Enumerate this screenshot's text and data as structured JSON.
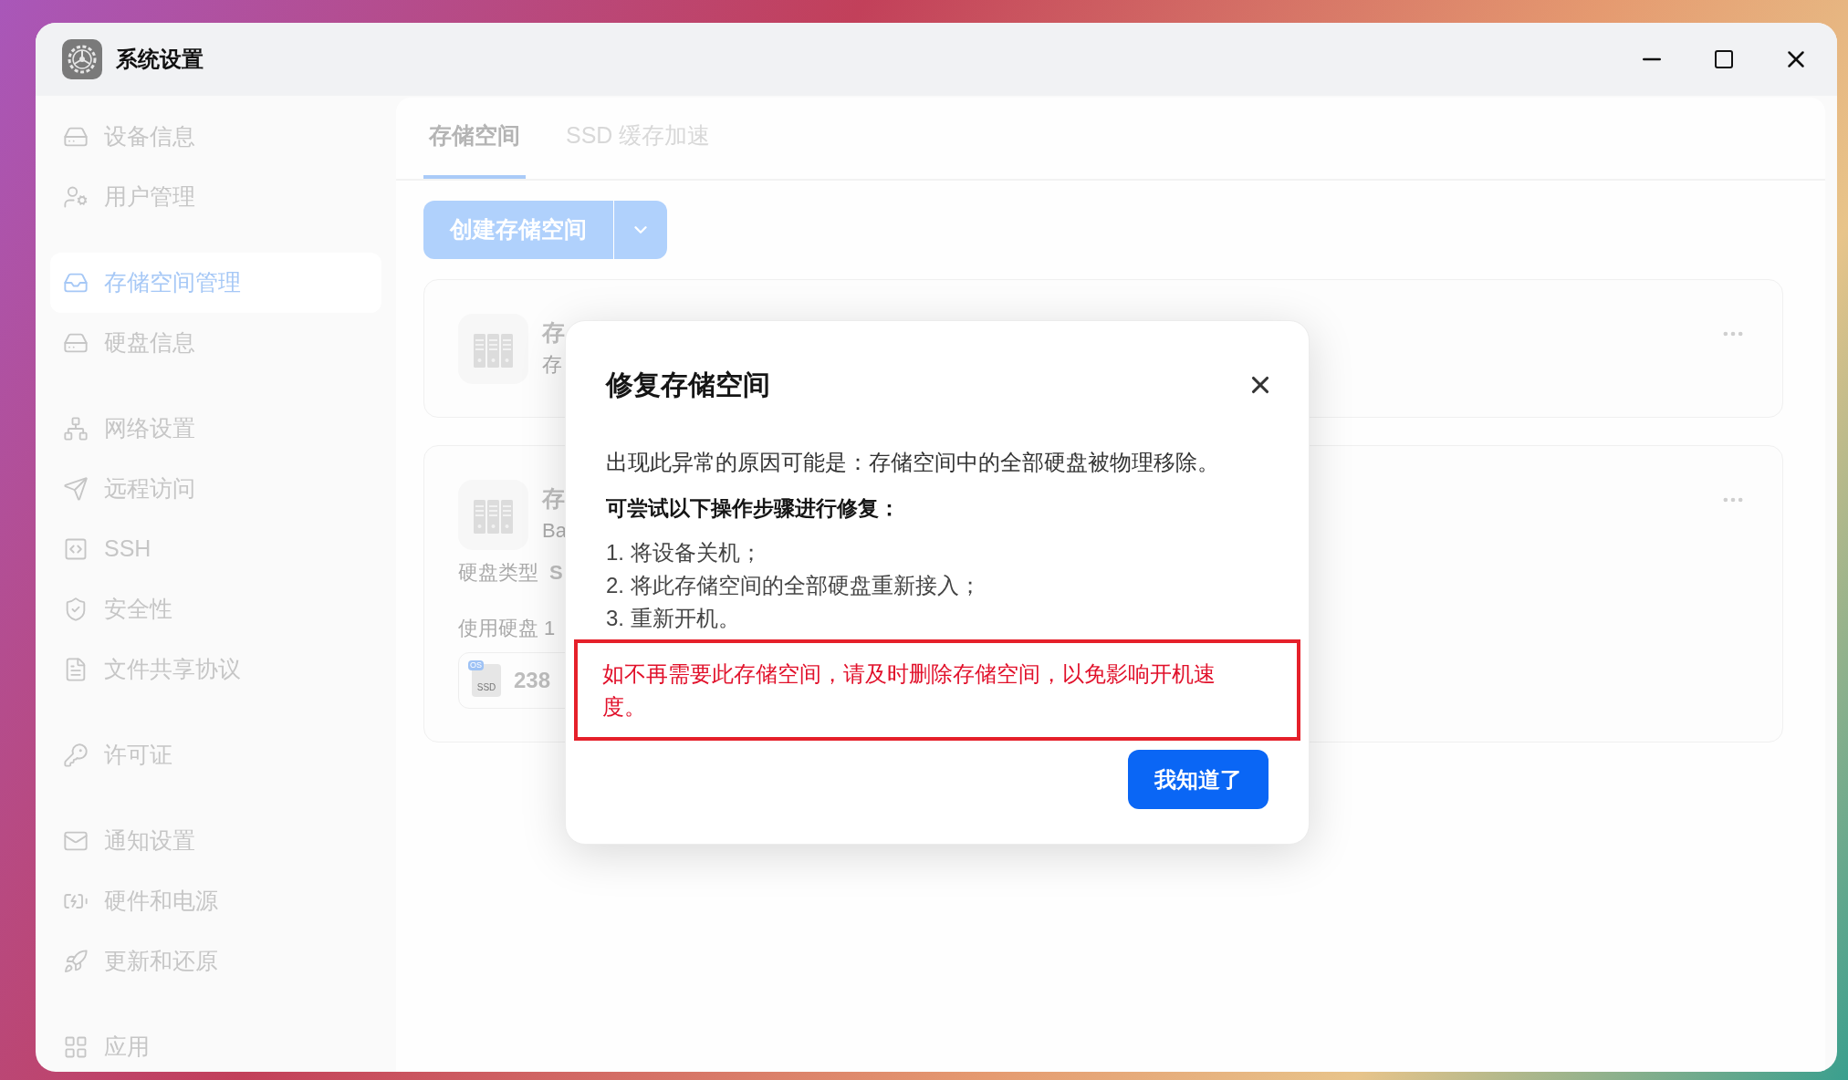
{
  "window": {
    "title": "系统设置"
  },
  "sidebar": {
    "groups": [
      {
        "items": [
          {
            "label": "设备信息",
            "selected": false
          },
          {
            "label": "用户管理",
            "selected": false
          }
        ]
      },
      {
        "items": [
          {
            "label": "存储空间管理",
            "selected": true
          },
          {
            "label": "硬盘信息",
            "selected": false
          }
        ]
      },
      {
        "items": [
          {
            "label": "网络设置",
            "selected": false
          },
          {
            "label": "远程访问",
            "selected": false
          },
          {
            "label": "SSH",
            "selected": false
          },
          {
            "label": "安全性",
            "selected": false
          },
          {
            "label": "文件共享协议",
            "selected": false
          }
        ]
      },
      {
        "items": [
          {
            "label": "许可证",
            "selected": false
          }
        ]
      },
      {
        "items": [
          {
            "label": "通知设置",
            "selected": false
          },
          {
            "label": "硬件和电源",
            "selected": false
          },
          {
            "label": "更新和还原",
            "selected": false
          }
        ]
      },
      {
        "items": [
          {
            "label": "应用",
            "selected": false
          }
        ]
      }
    ]
  },
  "tabs": [
    {
      "label": "存储空间",
      "selected": true
    },
    {
      "label": "SSD 缓存加速",
      "selected": false
    }
  ],
  "create_button": {
    "label": "创建存储空间"
  },
  "cards": [
    {
      "title": "存",
      "subtitle": "存"
    },
    {
      "title": "存",
      "subtitle": "Ba",
      "disk_type_label": "硬盘类型",
      "disk_type": "S",
      "disks_label": "使用硬盘 1",
      "disk": {
        "badge": "OS",
        "icon_text": "SSD",
        "size": "238"
      }
    }
  ],
  "dialog": {
    "title": "修复存储空间",
    "reason": "出现此异常的原因可能是：存储空间中的全部硬盘被物理移除。",
    "steps_heading": "可尝试以下操作步骤进行修复：",
    "steps": [
      "1. 将设备关机；",
      "2. 将此存储空间的全部硬盘重新接入；",
      "3. 重新开机。"
    ],
    "warning": "如不再需要此存储空间，请及时删除存储空间，以免影响开机速度。",
    "confirm": "我知道了"
  }
}
